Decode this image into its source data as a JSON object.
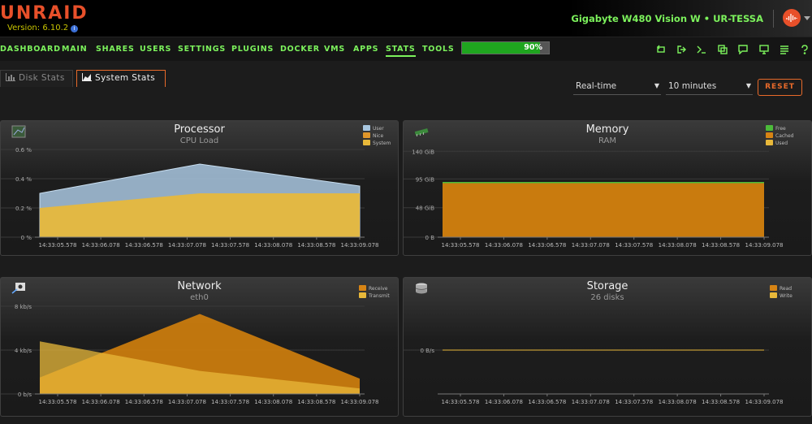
{
  "header": {
    "logo": "UNRAID",
    "version": "Version: 6.10.2",
    "server_model": "Gigabyte W480 Vision W",
    "server_sep": "•",
    "server_name": "UR-TESSA"
  },
  "nav": {
    "items": [
      "DASHBOARD",
      "MAIN",
      "SHARES",
      "USERS",
      "SETTINGS",
      "PLUGINS",
      "DOCKER",
      "VMS",
      "APPS",
      "STATS",
      "TOOLS"
    ],
    "active": "STATS",
    "progress_label": "90%",
    "progress_value": 0.9,
    "icons": [
      "refresh-icon",
      "logout-icon",
      "terminal-icon",
      "copy-icon",
      "feedback-icon",
      "info-icon",
      "log-icon",
      "help-icon"
    ]
  },
  "tabs": [
    "Disk Stats",
    "System Stats"
  ],
  "active_tab": "System Stats",
  "controls": {
    "mode": "Real-time",
    "range": "10 minutes",
    "reset": "RESET"
  },
  "colors": {
    "accent": "#e86a2a",
    "nav_green": "#7cf25c",
    "user": "#a9c7e0",
    "nice": "#e0962a",
    "system": "#e8b83a",
    "free": "#4cbb3a",
    "cached": "#d78414",
    "used": "#e8b83a",
    "receive": "#d78414",
    "transmit": "#e8b83a",
    "read": "#d78414",
    "write": "#e8b83a"
  },
  "chart_data": [
    {
      "type": "area",
      "title": "Processor",
      "subtitle": "CPU Load",
      "x": [
        "14:33:05.578",
        "14:33:06.078",
        "14:33:06.578",
        "14:33:07.078",
        "14:33:07.578",
        "14:33:08.078",
        "14:33:08.578",
        "14:33:09.078"
      ],
      "y_ticks": [
        "0 %",
        "0.2 %",
        "0.4 %",
        "0.6 %"
      ],
      "ylim": [
        0,
        0.6
      ],
      "stacked": true,
      "series": [
        {
          "name": "User",
          "points": [
            [
              0,
              0.1
            ],
            [
              4,
              0.2
            ],
            [
              8,
              0.05
            ]
          ]
        },
        {
          "name": "Nice",
          "points": [
            [
              0,
              0
            ],
            [
              8,
              0
            ]
          ]
        },
        {
          "name": "System",
          "points": [
            [
              0,
              0.2
            ],
            [
              4,
              0.3
            ],
            [
              8,
              0.3
            ]
          ]
        }
      ]
    },
    {
      "type": "area",
      "title": "Memory",
      "subtitle": "RAM",
      "x": [
        "14:33:05.578",
        "14:33:06.078",
        "14:33:06.578",
        "14:33:07.078",
        "14:33:07.578",
        "14:33:08.078",
        "14:33:08.578",
        "14:33:09.078"
      ],
      "y_ticks": [
        "0 B",
        "48 GiB",
        "95 GiB",
        "140 GiB"
      ],
      "ylim": [
        0,
        143
      ],
      "stacked": true,
      "series": [
        {
          "name": "Free",
          "points": [
            [
              0,
              1
            ],
            [
              8,
              1
            ]
          ]
        },
        {
          "name": "Cached",
          "points": [
            [
              0,
              88
            ],
            [
              8,
              88
            ]
          ]
        },
        {
          "name": "Used",
          "points": [
            [
              0,
              0
            ],
            [
              8,
              0
            ]
          ]
        }
      ]
    },
    {
      "type": "area",
      "title": "Network",
      "subtitle": "eth0",
      "x": [
        "14:33:05.578",
        "14:33:06.078",
        "14:33:06.578",
        "14:33:07.078",
        "14:33:07.578",
        "14:33:08.078",
        "14:33:08.578",
        "14:33:09.078"
      ],
      "y_ticks": [
        "0 b/s",
        "4 kb/s",
        "8 kb/s"
      ],
      "ylim": [
        0,
        8
      ],
      "stacked": false,
      "series": [
        {
          "name": "Receive",
          "points": [
            [
              0,
              1.5
            ],
            [
              4,
              7.3
            ],
            [
              8,
              1.4
            ]
          ]
        },
        {
          "name": "Transmit",
          "points": [
            [
              0,
              4.8
            ],
            [
              4,
              2.1
            ],
            [
              8,
              0.5
            ]
          ]
        }
      ]
    },
    {
      "type": "area",
      "title": "Storage",
      "subtitle": "26 disks",
      "x": [
        "14:33:05.578",
        "14:33:06.078",
        "14:33:06.578",
        "14:33:07.078",
        "14:33:07.578",
        "14:33:08.078",
        "14:33:08.578",
        "14:33:09.078"
      ],
      "y_ticks": [
        "0 B/s"
      ],
      "ylim": [
        0,
        1
      ],
      "stacked": false,
      "series": [
        {
          "name": "Read",
          "points": [
            [
              0,
              0
            ],
            [
              8,
              0
            ]
          ]
        },
        {
          "name": "Write",
          "points": [
            [
              0,
              0
            ],
            [
              8,
              0
            ]
          ]
        }
      ]
    }
  ]
}
